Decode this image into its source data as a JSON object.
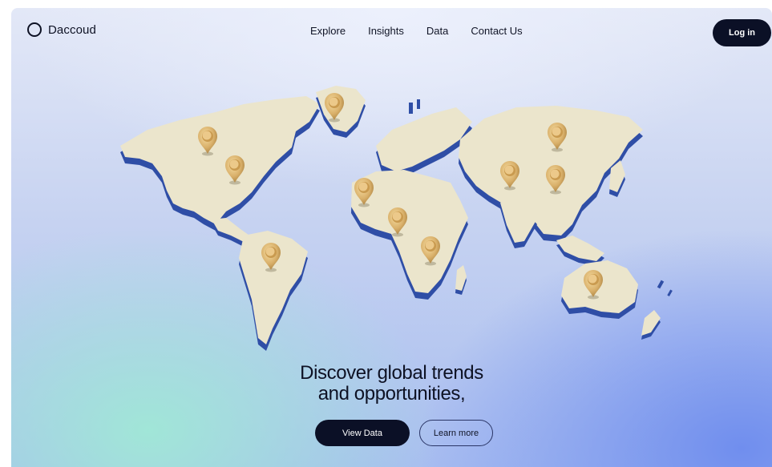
{
  "brand": {
    "name": "Daccoud",
    "icon": "ring-logo-icon"
  },
  "nav": {
    "links": [
      "Explore",
      "Insights",
      "Data",
      "Contact Us"
    ],
    "login_label": "Log in"
  },
  "hero": {
    "headline_line1": "Discover global trends",
    "headline_line2": "and opportunities,",
    "primary_label": "View Data",
    "secondary_label": "Learn more"
  },
  "map": {
    "icon": "world-map-illustration",
    "pin_icon": "location-pin-icon",
    "land_color": "#ebe5cc",
    "extrusion_color": "#2f4ea6",
    "pin_color": "#d9b06a"
  },
  "colors": {
    "dark": "#0b1026",
    "background_top": "#e3e8f7",
    "background_mint": "#a0e8d6",
    "background_blue": "#708eee"
  }
}
